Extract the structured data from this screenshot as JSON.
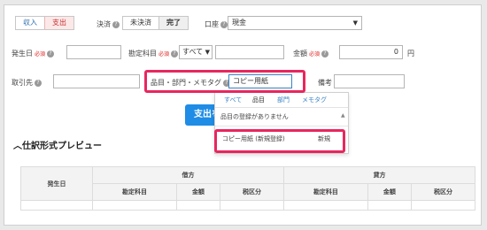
{
  "type_toggle": {
    "income": "収入",
    "expense": "支出"
  },
  "settlement": {
    "label": "決済",
    "undone": "未決済",
    "done": "完了"
  },
  "account": {
    "label": "口座",
    "value": "現金"
  },
  "date": {
    "label": "発生日",
    "required": "必須",
    "value": ""
  },
  "accounting": {
    "label": "勘定科目",
    "required": "必須",
    "filter": "すべて",
    "value": ""
  },
  "amount": {
    "label": "金額",
    "required": "必須",
    "value": "0",
    "unit": "円"
  },
  "partner": {
    "label": "取引先",
    "value": ""
  },
  "item_field": {
    "label": "品目・部門・メモタグ",
    "value": "コピー用紙"
  },
  "remarks": {
    "label": "備考",
    "value": ""
  },
  "submit": {
    "label": "支出を"
  },
  "dropdown": {
    "tabs": [
      "すべて",
      "品目",
      "部門",
      "メモタグ"
    ],
    "empty_text": "品目の登録がありません",
    "suggestion": "コピー用紙 (新規登録)",
    "suggestion_badge": "新規"
  },
  "preview": {
    "title": "仕訳形式プレビュー",
    "col_date": "発生日",
    "debit": "借方",
    "credit": "貸方",
    "sub": [
      "勘定科目",
      "金額",
      "税区分",
      "勘定科目",
      "金額",
      "税区分"
    ]
  },
  "colors": {
    "highlight": "#e8265e",
    "primary": "#1f8ce6"
  }
}
